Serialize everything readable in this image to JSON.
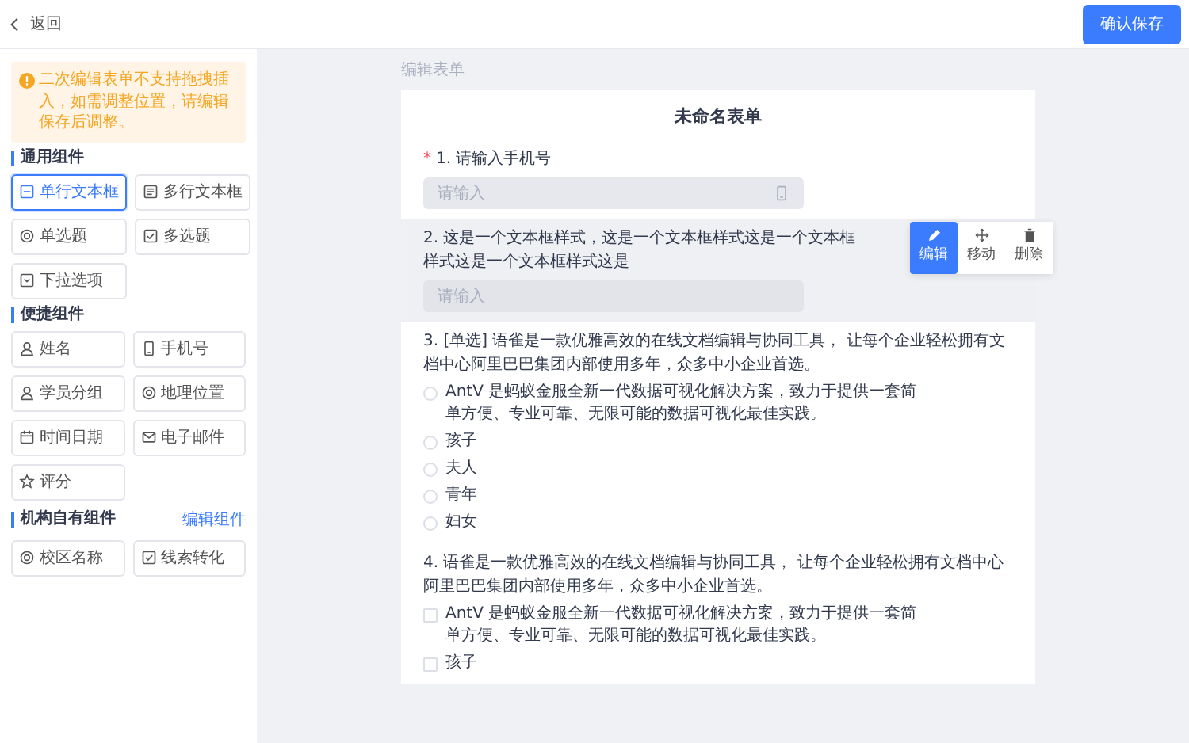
{
  "header": {
    "back_label": "返回",
    "save_button": "确认保存"
  },
  "sidebar": {
    "notice": "二次编辑表单不支持拖拽插入，如需调整位置，请编辑保存后调整。",
    "groups": [
      {
        "title": "通用组件",
        "items": [
          {
            "label": "单行文本框",
            "highlighted": true
          },
          {
            "label": "多行文本框",
            "highlighted": false
          },
          {
            "label": "单选题",
            "highlighted": false
          },
          {
            "label": "多选题",
            "highlighted": false
          },
          {
            "label": "下拉选项",
            "highlighted": false
          }
        ]
      },
      {
        "title": "便捷组件",
        "items": [
          {
            "label": "姓名",
            "highlighted": false
          },
          {
            "label": "手机号",
            "highlighted": false
          },
          {
            "label": "学员分组",
            "highlighted": false
          },
          {
            "label": "地理位置",
            "highlighted": false
          },
          {
            "label": "时间日期",
            "highlighted": false
          },
          {
            "label": "电子邮件",
            "highlighted": false
          },
          {
            "label": "评分",
            "highlighted": false
          }
        ]
      },
      {
        "title": "机构自有组件",
        "action": "编辑组件",
        "items": [
          {
            "label": "校区名称",
            "highlighted": false
          },
          {
            "label": "线索转化",
            "highlighted": false
          }
        ]
      }
    ]
  },
  "main": {
    "section_title": "编辑表单",
    "form": {
      "title": "未命名表单",
      "questions": [
        {
          "kind": "input",
          "required_mark": "*",
          "label": "1. 请输入手机号",
          "placeholder": "请输入",
          "active": false
        },
        {
          "kind": "input",
          "label": "2. 这是一个文本框样式，这是一个文本框样式这是一个文本框样式这是一个文本框样式这是",
          "placeholder": "请输入",
          "active": true,
          "toolbar": [
            {
              "label": "编辑",
              "selected": true
            },
            {
              "label": "移动",
              "selected": false
            },
            {
              "label": "删除",
              "selected": false
            }
          ]
        },
        {
          "kind": "radio",
          "label": "3. [单选] 语雀是一款优雅高效的在线文档编辑与协同工具， 让每个企业轻松拥有文档中心阿里巴巴集团内部使用多年，众多中小企业首选。",
          "active": false,
          "options": [
            "AntV 是蚂蚁金服全新一代数据可视化解决方案，致力于提供一套简单方便、专业可靠、无限可能的数据可视化最佳实践。",
            "孩子",
            "夫人",
            "青年",
            "妇女"
          ]
        },
        {
          "kind": "checkbox",
          "label": "4. 语雀是一款优雅高效的在线文档编辑与协同工具， 让每个企业轻松拥有文档中心阿里巴巴集团内部使用多年，众多中小企业首选。",
          "active": false,
          "options": [
            "AntV 是蚂蚁金服全新一代数据可视化解决方案，致力于提供一套简单方便、专业可靠、无限可能的数据可视化最佳实践。",
            "孩子"
          ]
        }
      ]
    }
  }
}
